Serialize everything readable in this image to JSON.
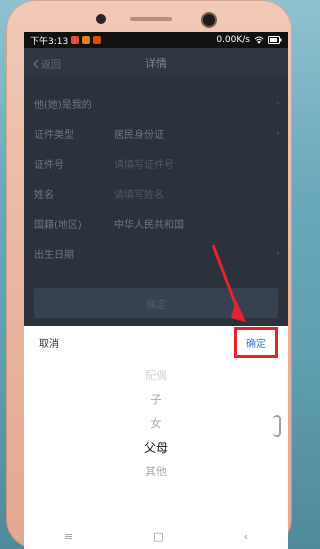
{
  "status_bar": {
    "time": "下午3:13",
    "network_speed": "0.00K/s"
  },
  "header": {
    "back_label": "返回",
    "title": "详情"
  },
  "form": {
    "relation_label": "他(她)是我的",
    "id_type_label": "证件类型",
    "id_type_value": "居民身份证",
    "id_number_label": "证件号",
    "id_number_placeholder": "请填写证件号",
    "name_label": "姓名",
    "name_placeholder": "请填写姓名",
    "country_label": "国籍(地区)",
    "country_value": "中华人民共和国",
    "birthdate_label": "出生日期",
    "submit_label": "确定"
  },
  "picker": {
    "cancel_label": "取消",
    "confirm_label": "确定",
    "options": [
      "配偶",
      "子",
      "女",
      "父母",
      "其他"
    ],
    "selected_index": 3
  },
  "colors": {
    "accent": "#3a7bd5",
    "highlight": "#e3232e"
  }
}
